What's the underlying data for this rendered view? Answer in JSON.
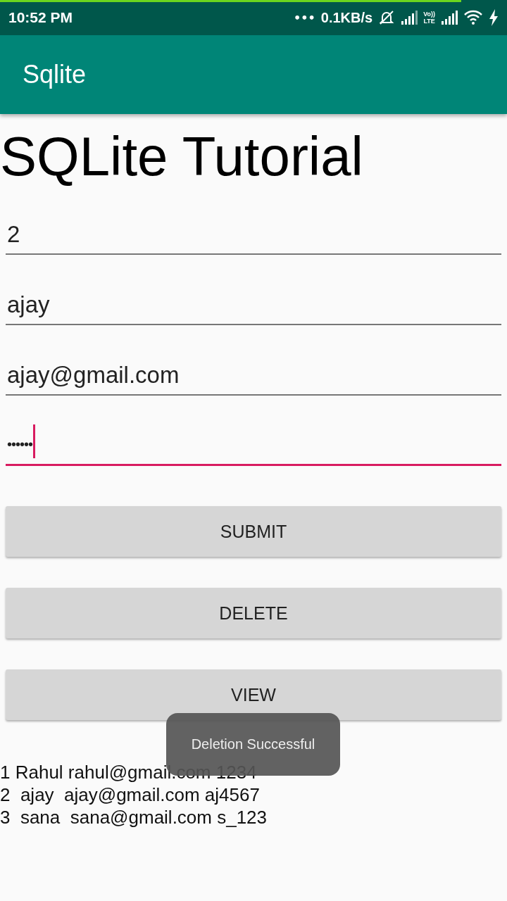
{
  "status_bar": {
    "time": "10:52 PM",
    "more": "•••",
    "speed": "0.1KB/s",
    "volte": [
      "Vo))",
      "LTE"
    ]
  },
  "app_bar": {
    "title": "Sqlite"
  },
  "heading": "SQLite Tutorial",
  "fields": [
    {
      "kind": "text",
      "value": "2",
      "focused": false
    },
    {
      "kind": "text",
      "value": "ajay",
      "focused": false
    },
    {
      "kind": "text",
      "value": "ajay@gmail.com",
      "focused": false
    },
    {
      "kind": "password",
      "value": "••••••",
      "focused": true
    }
  ],
  "buttons": [
    "SUBMIT",
    "DELETE",
    "VIEW"
  ],
  "records": [
    "1 Rahul rahul@gmail.com 1234",
    "2  ajay  ajay@gmail.com aj4567",
    "3  sana  sana@gmail.com s_123"
  ],
  "toast": "Deletion Successful"
}
